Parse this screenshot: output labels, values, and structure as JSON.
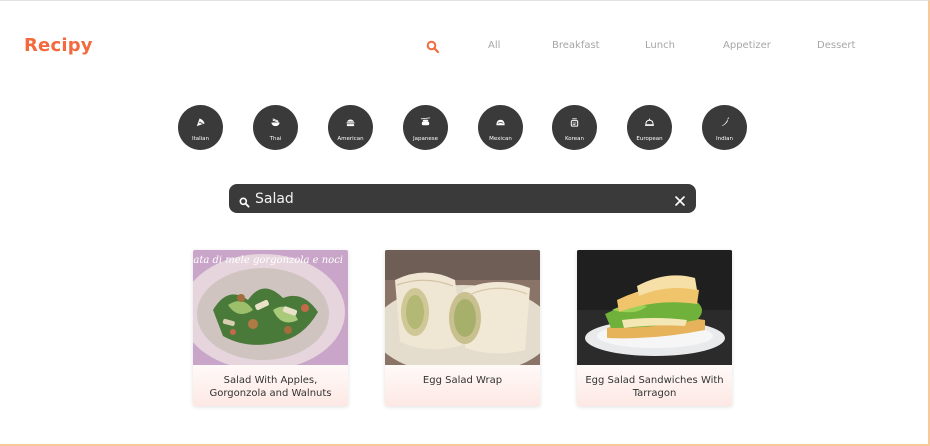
{
  "app": {
    "logo": "Recipy",
    "accent_color": "#f26a3d"
  },
  "nav": {
    "search_icon": "search-icon",
    "items": [
      {
        "label": "All"
      },
      {
        "label": "Breakfast"
      },
      {
        "label": "Lunch"
      },
      {
        "label": "Appetizer"
      },
      {
        "label": "Dessert"
      }
    ]
  },
  "cuisines": [
    {
      "label": "Italian",
      "icon": "pizza-icon"
    },
    {
      "label": "Thai",
      "icon": "noodle-bowl-icon"
    },
    {
      "label": "American",
      "icon": "burger-icon"
    },
    {
      "label": "Japanese",
      "icon": "sushi-icon"
    },
    {
      "label": "Mexican",
      "icon": "taco-icon"
    },
    {
      "label": "Korean",
      "icon": "kimchi-icon"
    },
    {
      "label": "European",
      "icon": "cloche-icon"
    },
    {
      "label": "Indian",
      "icon": "chili-icon"
    }
  ],
  "search": {
    "value": "Salad",
    "icon": "search-icon",
    "clear_icon": "close-icon",
    "background": "#3a3a3a"
  },
  "results": [
    {
      "title": "Salad With Apples, Gorgonzola and Walnuts",
      "image": "salad-photo",
      "overlay_text": "Insalata di mele gorgonzola e noci"
    },
    {
      "title": "Egg Salad Wrap",
      "image": "wrap-photo"
    },
    {
      "title": "Egg Salad Sandwiches With Tarragon",
      "image": "sandwich-photo"
    }
  ]
}
